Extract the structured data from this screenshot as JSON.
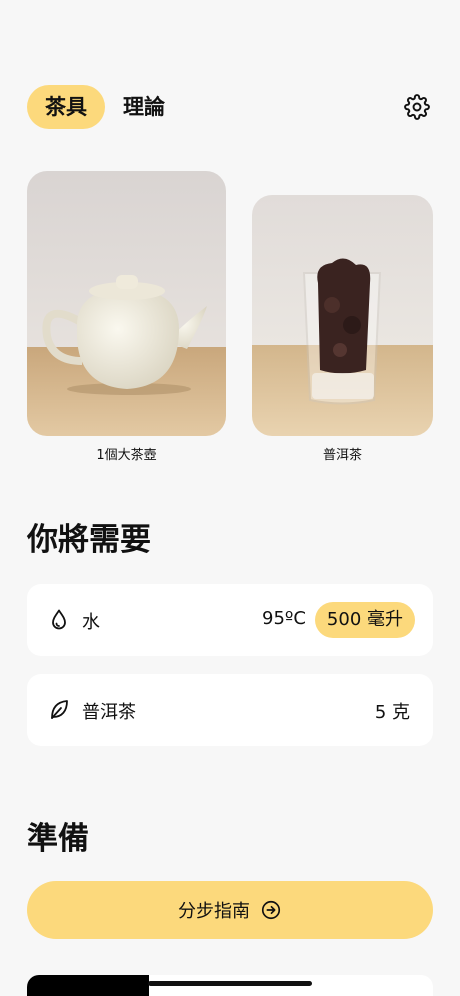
{
  "tabs": [
    {
      "label": "茶具",
      "active": true
    },
    {
      "label": "理論",
      "active": false
    }
  ],
  "equipment": [
    {
      "caption": "1個大茶壺"
    },
    {
      "caption": "普洱茶"
    }
  ],
  "need_section": {
    "title": "你將需要",
    "items": [
      {
        "icon": "water-drop-icon",
        "label": "水",
        "temperature": "95ºC",
        "amount": "500 毫升"
      },
      {
        "icon": "leaf-icon",
        "label": "普洱茶",
        "amount": "5 克"
      }
    ]
  },
  "prep_section": {
    "title": "準備",
    "guide_button": "分步指南"
  },
  "colors": {
    "accent": "#fcd97c",
    "background": "#f7f7f7",
    "card": "#ffffff"
  }
}
